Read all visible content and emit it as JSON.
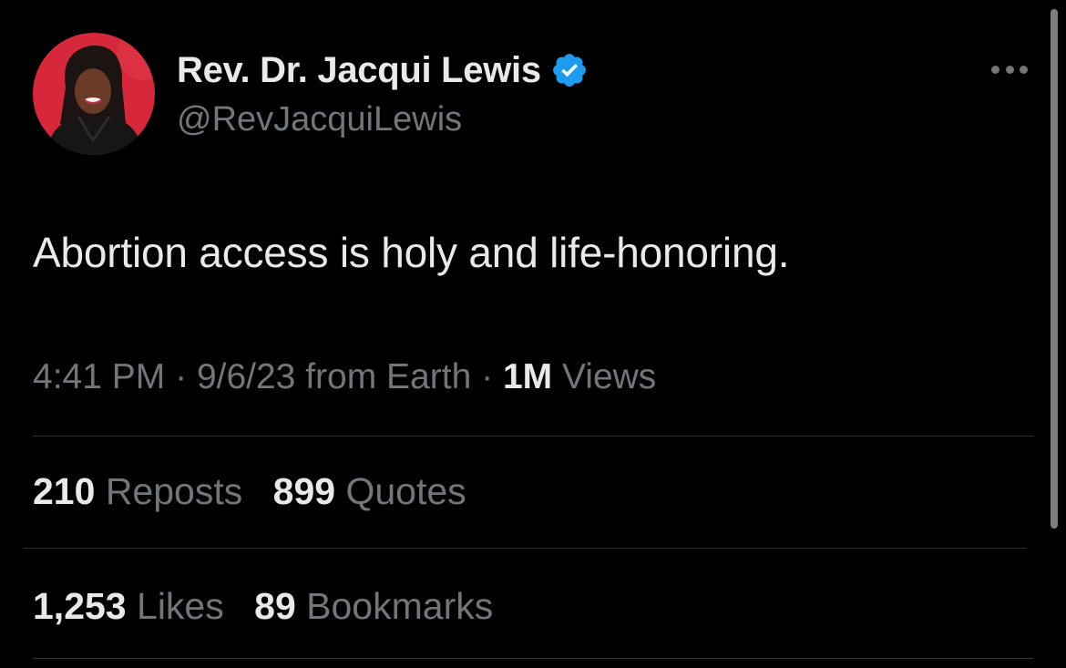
{
  "author": {
    "display_name": "Rev. Dr. Jacqui Lewis",
    "handle": "@RevJacquiLewis",
    "verified_color": "#1d9bf0"
  },
  "tweet": {
    "text": "Abortion access is holy and life-honoring."
  },
  "meta": {
    "time": "4:41 PM",
    "separator": "·",
    "date_source": "9/6/23 from Earth",
    "views_count": "1M",
    "views_label": "Views"
  },
  "stats": {
    "reposts_count": "210",
    "reposts_label": "Reposts",
    "quotes_count": "899",
    "quotes_label": "Quotes",
    "likes_count": "1,253",
    "likes_label": "Likes",
    "bookmarks_count": "89",
    "bookmarks_label": "Bookmarks"
  },
  "icons": {
    "verified": "verified-badge-icon",
    "more": "more-options-icon"
  },
  "colors": {
    "background": "#000000",
    "primary_text": "#e7e9ea",
    "secondary_text": "#71767b",
    "divider": "#2f3336",
    "avatar_bg": "#d6283a"
  }
}
